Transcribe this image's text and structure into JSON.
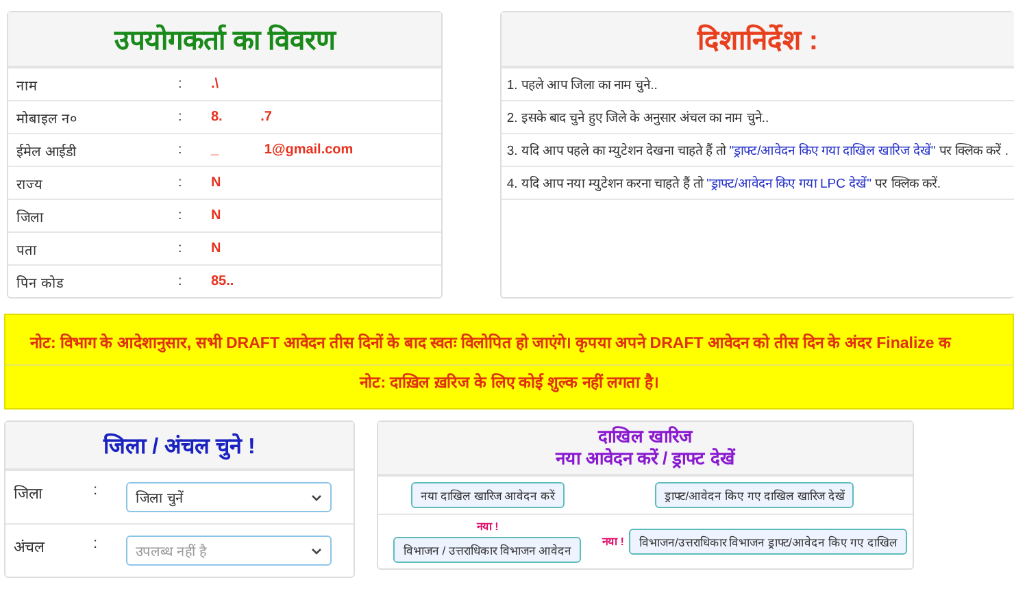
{
  "user_details": {
    "title": "उपयोगकर्ता का विवरण",
    "rows": [
      {
        "label": "नाम",
        "separator": ":",
        "value": ".\\"
      },
      {
        "label": "मोबाइल न०",
        "separator": ":",
        "value": "8.          .7"
      },
      {
        "label": "ईमेल आईडी",
        "separator": ":",
        "value": "_            1@gmail.com"
      },
      {
        "label": "राज्य",
        "separator": ":",
        "value": "N"
      },
      {
        "label": "जिला",
        "separator": ":",
        "value": "N"
      },
      {
        "label": "पता",
        "separator": ":",
        "value": "N"
      },
      {
        "label": "पिन कोड",
        "separator": ":",
        "value": "85.."
      }
    ]
  },
  "guidelines": {
    "title": "दिशानिर्देश :",
    "items": [
      {
        "before": "1. पहले आप जिला का नाम चुने.."
      },
      {
        "before": "2. इसके बाद चुने हुए जिले के अनुसार अंचल का नाम चुने.."
      },
      {
        "before": "3. यदि आप पहले का म्युटेशन देखना चाहते हैं तो ",
        "link": "\"ड्राफ्ट/आवेदन किए गया दाखिल खारिज देखें\"",
        "after": " पर क्लिक करें ."
      },
      {
        "before": "4. यदि आप नया म्युटेशन करना चाहते हैं तो ",
        "link": "\"ड्राफ्ट/आवेदन किए गया LPC देखें\"",
        "after": " पर क्लिक करें."
      }
    ]
  },
  "notice": {
    "lines": [
      "नोट: विभाग के आदेशानुसार, सभी DRAFT आवेदन तीस दिनों के बाद स्वतः विलोपित हो जाएंगे। कृपया अपने DRAFT आवेदन को तीस दिन के अंदर Finalize क",
      "नोट: दाख़िल ख़रिज के लिए कोई शुल्क नहीं लगता है।"
    ]
  },
  "district_select": {
    "title": "जिला / अंचल चुने !",
    "fields": [
      {
        "label": "जिला",
        "separator": ":",
        "value": "जिला चुनें"
      },
      {
        "label": "अंचल",
        "separator": ":",
        "placeholder": "उपलब्ध नहीं है"
      }
    ]
  },
  "mutation": {
    "title_lines": [
      "दाखिल खारिज",
      "नया आवेदन करें / ड्राफ्ट देखें"
    ],
    "buttons": [
      {
        "label": "नया दाखिल खारिज आवेदन करें"
      },
      {
        "label": "ड्राफ्ट/आवेदन किए गए दाखिल खारिज देखें"
      },
      {
        "label": "विभाजन / उत्तराधिकार विभाजन आवेदन",
        "badge": "नया !"
      },
      {
        "label": "विभाजन/उत्तराधिकार विभाजन ड्राफ्ट/आवेदन किए गए दाखिल",
        "badge": "नया !"
      }
    ]
  }
}
